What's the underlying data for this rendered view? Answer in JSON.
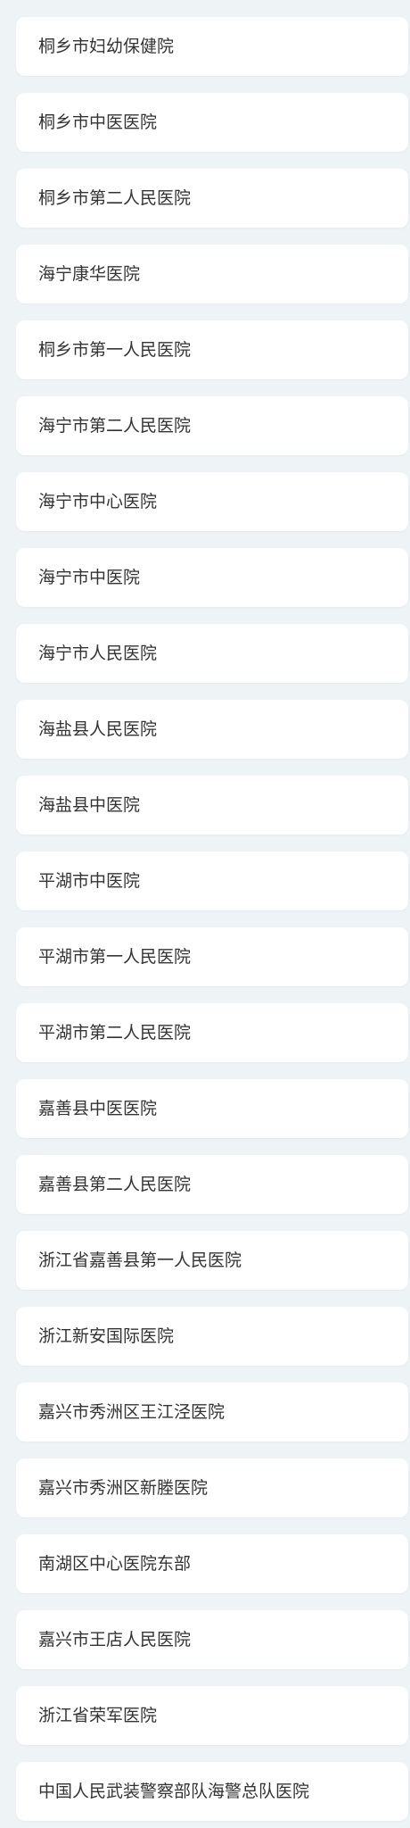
{
  "hospitals": [
    "桐乡市妇幼保健院",
    "桐乡市中医医院",
    "桐乡市第二人民医院",
    "海宁康华医院",
    "桐乡市第一人民医院",
    "海宁市第二人民医院",
    "海宁市中心医院",
    "海宁市中医院",
    "海宁市人民医院",
    "海盐县人民医院",
    "海盐县中医院",
    "平湖市中医院",
    "平湖市第一人民医院",
    "平湖市第二人民医院",
    "嘉善县中医医院",
    "嘉善县第二人民医院",
    "浙江省嘉善县第一人民医院",
    "浙江新安国际医院",
    "嘉兴市秀洲区王江泾医院",
    "嘉兴市秀洲区新塍医院",
    "南湖区中心医院东部",
    "嘉兴市王店人民医院",
    "浙江省荣军医院",
    "中国人民武装警察部队海警总队医院"
  ]
}
